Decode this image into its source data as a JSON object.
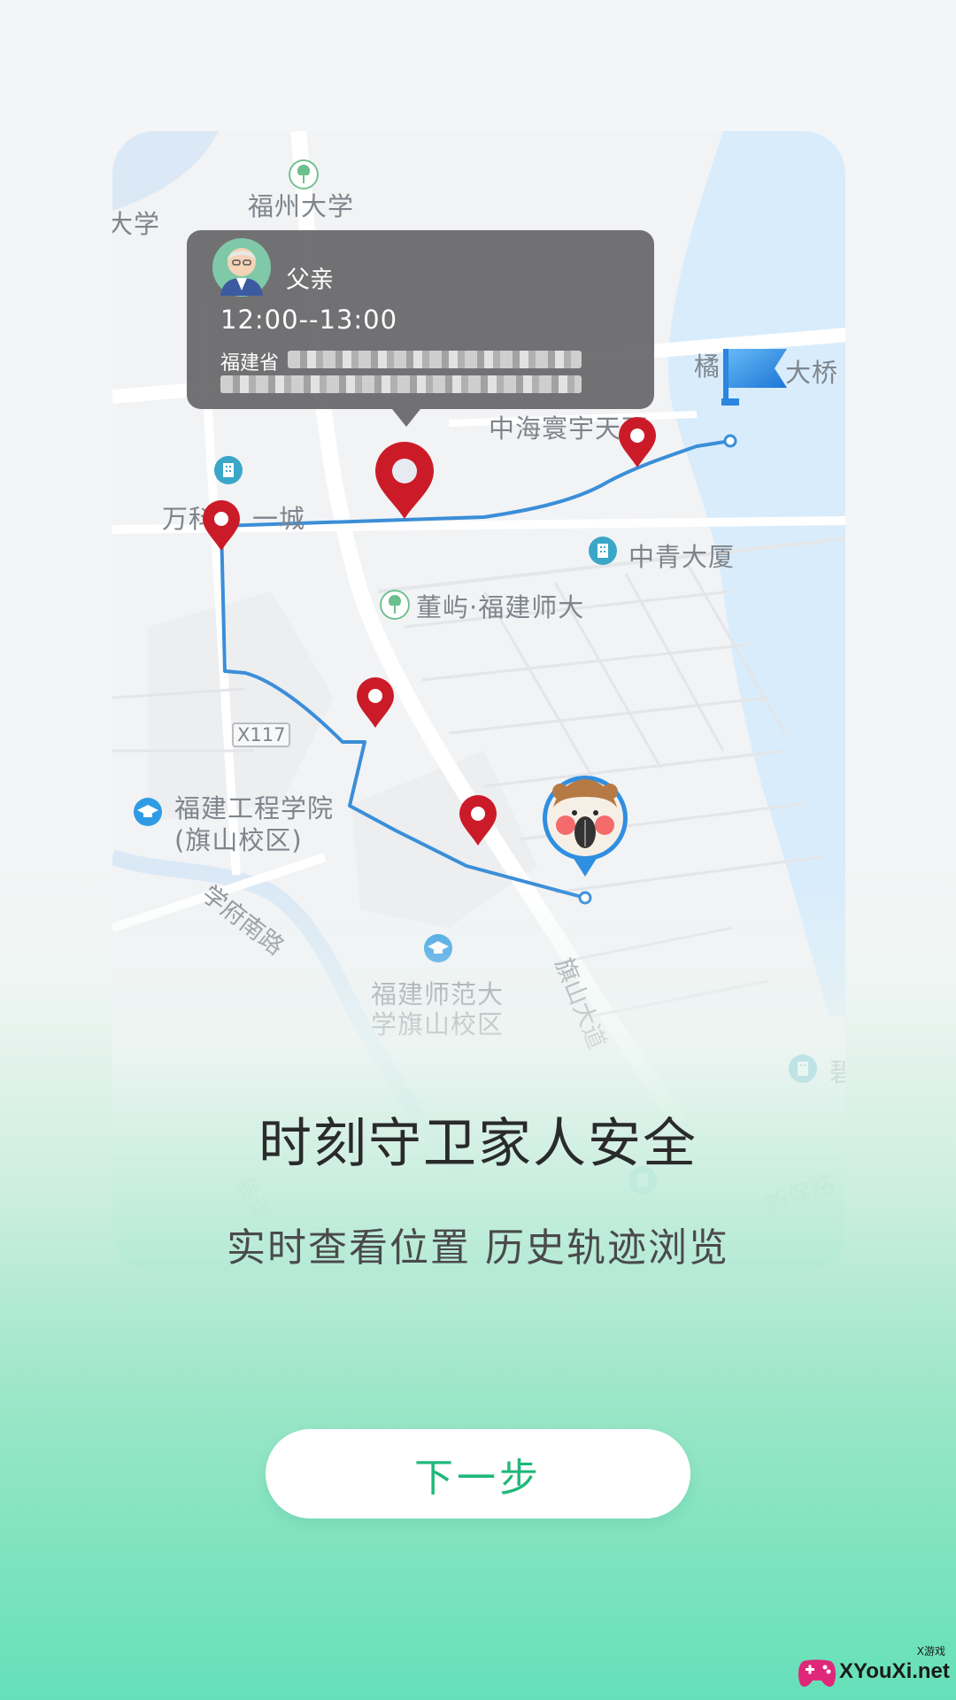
{
  "map": {
    "labels": {
      "fuzhou_university": "福州大学",
      "university_fragment": "大学",
      "zhonghai": "中海寰宇天下",
      "bridge_left": "橘",
      "bridge_right": "大桥",
      "vanke": "万科",
      "vanke_suffix": "一城",
      "zhongqing": "中青大厦",
      "dongyu": "董屿·福建师大",
      "road_x117": "X117",
      "fjut_line1": "福建工程学院",
      "fjut_line2": "(旗山校区)",
      "xuefu_south_road": "学府南路",
      "fjnu_line1": "福建师范大",
      "fjnu_line2": "学旗山校区",
      "qishan_avenue": "旗山大道",
      "xinbao_road": "新保路",
      "county_road": "县道",
      "edge_char": "碧"
    },
    "route_color": "#3b8ed8",
    "pin_color": "#cc1b28"
  },
  "popup": {
    "name": "父亲",
    "time": "12:00--13:00",
    "address_prefix": "福建省"
  },
  "intro": {
    "headline": "时刻守卫家人安全",
    "subline": "实时查看位置  历史轨迹浏览"
  },
  "next_button": "下一步",
  "watermark": {
    "text": "XYouXi.net",
    "small": "X游戏"
  }
}
